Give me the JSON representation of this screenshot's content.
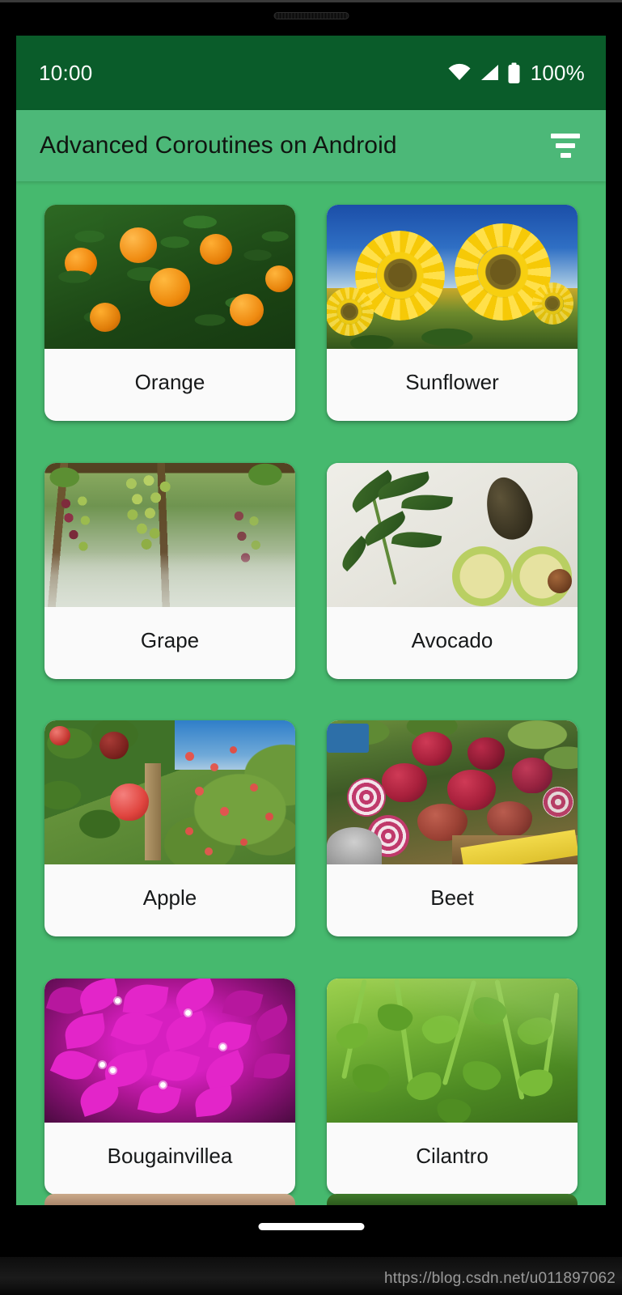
{
  "status_bar": {
    "time": "10:00",
    "battery_percent": "100%",
    "icons": [
      "wifi-icon",
      "cellular-signal-icon",
      "battery-icon"
    ],
    "background_color": "#0a5c2a"
  },
  "app_bar": {
    "title": "Advanced Coroutines on Android",
    "filter_icon": "filter-list-icon",
    "background_color": "#4cb878",
    "title_color": "#101510"
  },
  "content": {
    "background_color": "#46b96e"
  },
  "plants": [
    {
      "name": "Orange"
    },
    {
      "name": "Sunflower"
    },
    {
      "name": "Grape"
    },
    {
      "name": "Avocado"
    },
    {
      "name": "Apple"
    },
    {
      "name": "Beet"
    },
    {
      "name": "Bougainvillea"
    },
    {
      "name": "Cilantro"
    }
  ],
  "watermark": {
    "text": "https://blog.csdn.net/u011897062"
  }
}
